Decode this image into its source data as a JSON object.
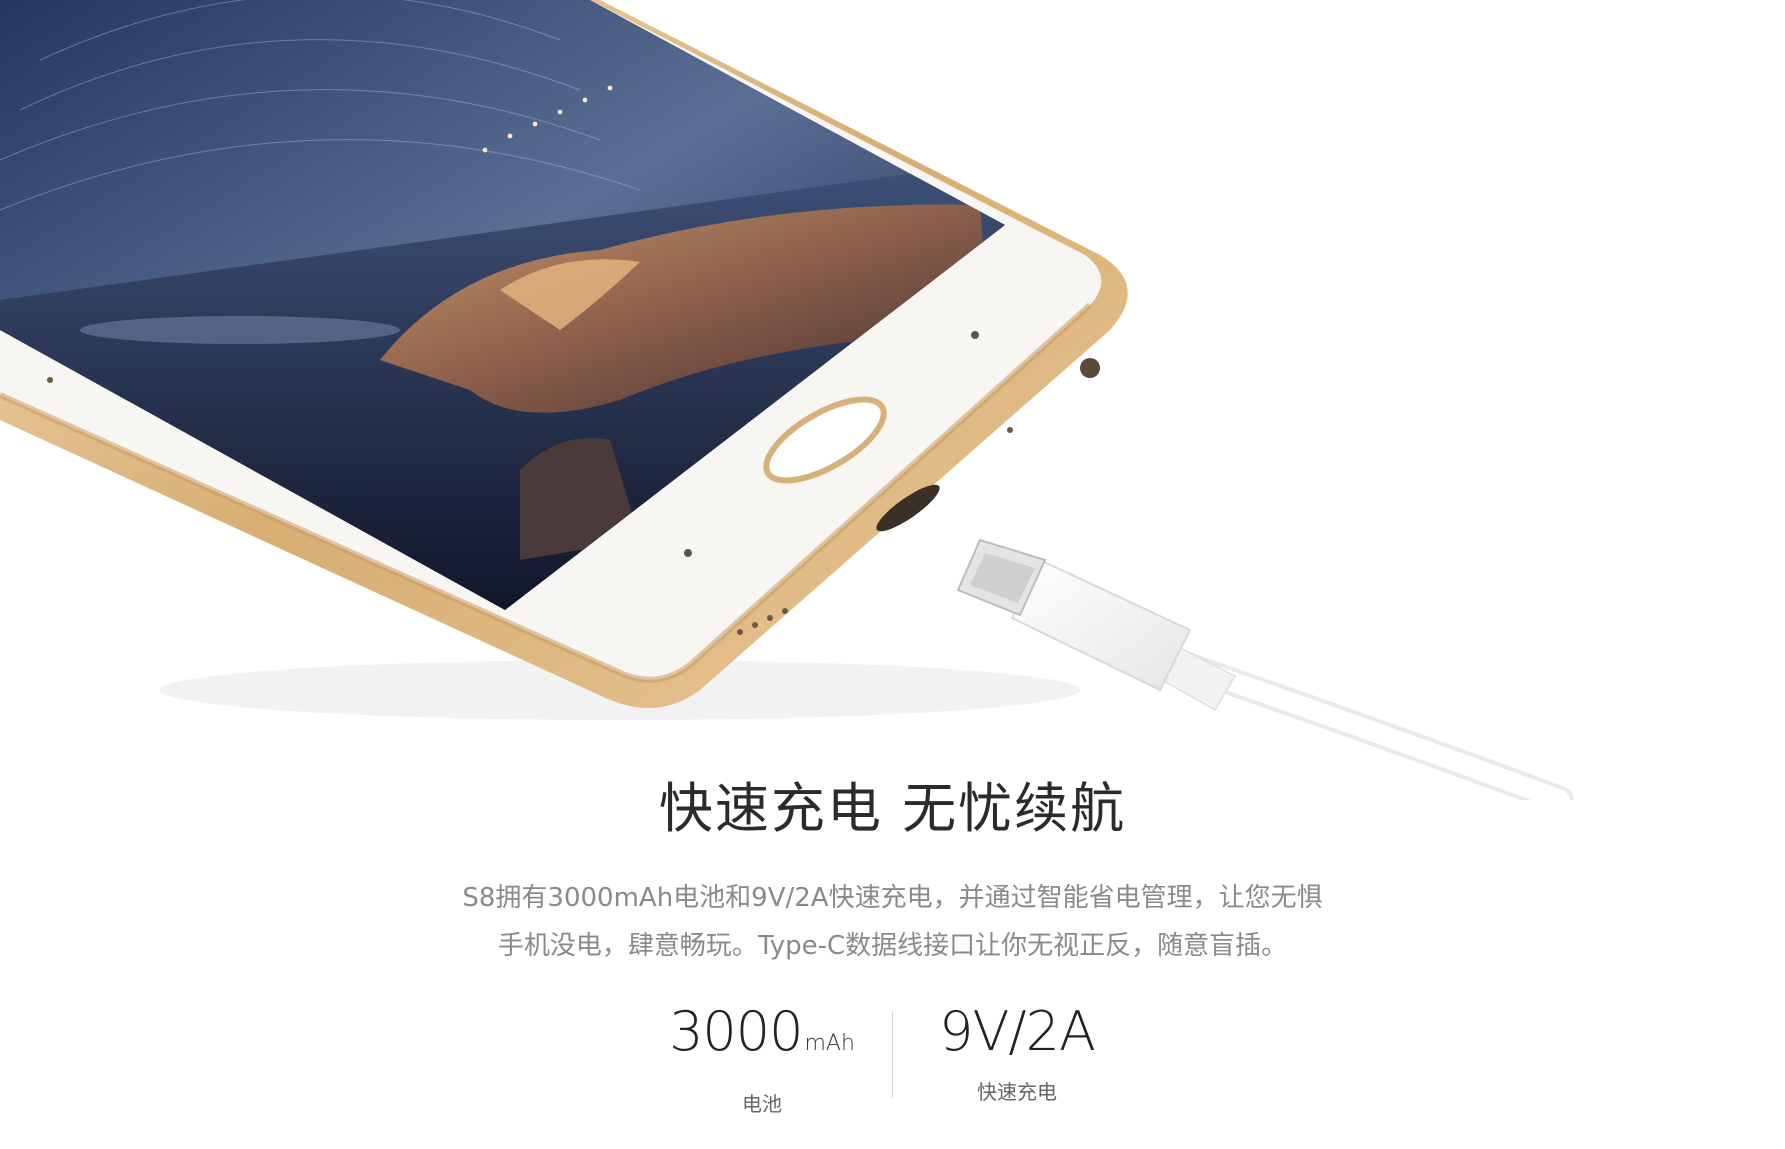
{
  "headline": "快速充电 无忧续航",
  "description": {
    "line1": "S8拥有3000mAh电池和9V/2A快速充电，并通过智能省电管理，让您无惧",
    "line2": "手机没电，肆意畅玩。Type-C数据线接口让你无视正反，随意盲插。"
  },
  "specs": {
    "battery": {
      "value": "3000",
      "unit": "mAh",
      "label": "电池"
    },
    "charging": {
      "value": "9V/2A",
      "label": "快速充电"
    }
  },
  "colors": {
    "gold_frame": "#d9b27c",
    "screen_dark": "#1c2a4a",
    "background": "#ffffff"
  }
}
